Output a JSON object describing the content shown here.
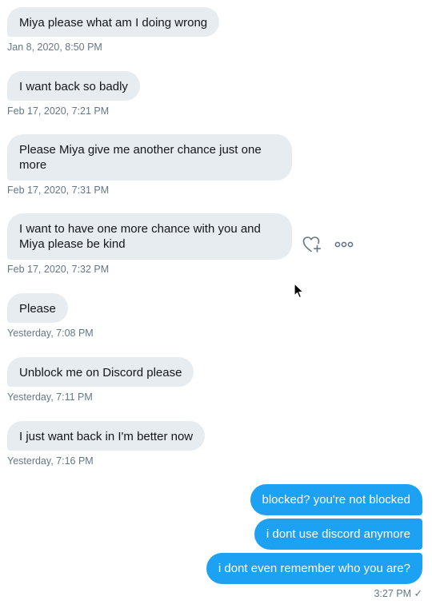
{
  "messages": [
    {
      "text": "Miya please what am I doing wrong",
      "time": "Jan 8, 2020, 8:50 PM"
    },
    {
      "text": "I want back so badly",
      "time": "Feb 17, 2020, 7:21 PM"
    },
    {
      "text": "Please Miya give me another chance just one more",
      "time": "Feb 17, 2020, 7:31 PM"
    },
    {
      "text": "I want to have one more chance with you and Miya please be kind",
      "time": "Feb 17, 2020, 7:32 PM"
    },
    {
      "text": "Please",
      "time": "Yesterday, 7:08 PM"
    },
    {
      "text": "Unblock me on Discord please",
      "time": "Yesterday, 7:11 PM"
    },
    {
      "text": "I just want back in I'm better now",
      "time": "Yesterday, 7:16 PM"
    }
  ],
  "replies": [
    {
      "text": "blocked? you're not blocked"
    },
    {
      "text": "i dont use discord anymore"
    },
    {
      "text": "i dont even remember who you are?"
    }
  ],
  "reply_time": "3:27 PM",
  "read_receipt": "✓",
  "icons": {
    "like": "heart-plus-icon",
    "more": "more-horizontal-icon"
  },
  "colors": {
    "incoming_bubble": "#e6ecf0",
    "outgoing_bubble": "#1da1f2",
    "timestamp": "#657786"
  }
}
